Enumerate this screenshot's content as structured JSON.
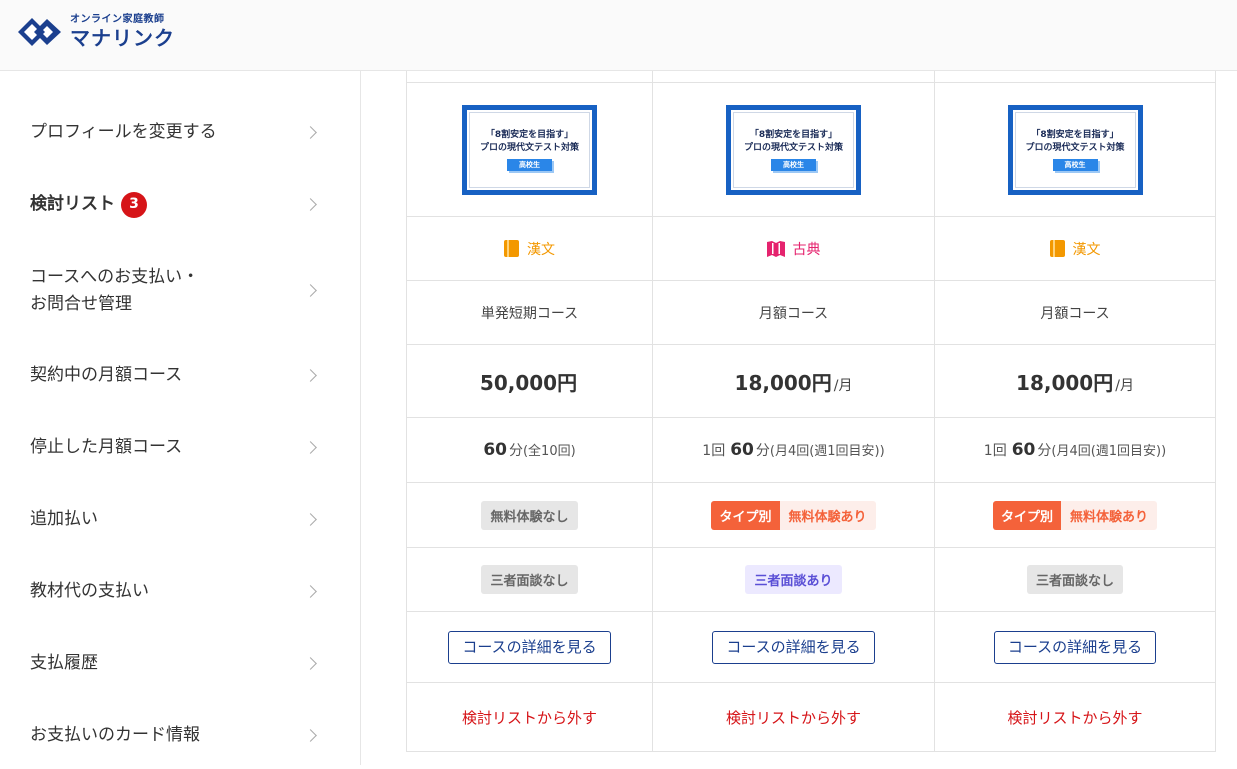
{
  "brand": {
    "sub": "オンライン家庭教師",
    "name": "マナリンク",
    "colors": {
      "primary": "#1b3f8e",
      "accent": "#1761c3",
      "danger": "#d61418"
    }
  },
  "sidebar": {
    "items": [
      {
        "label": "プロフィールを変更する"
      },
      {
        "label": "検討リスト",
        "badge": "3"
      },
      {
        "label": "コースへのお支払い・",
        "label2": "お問合せ管理"
      },
      {
        "label": "契約中の月額コース"
      },
      {
        "label": "停止した月額コース"
      },
      {
        "label": "追加払い"
      },
      {
        "label": "教材代の支払い"
      },
      {
        "label": "支払履歴"
      },
      {
        "label": "お支払いのカード情報"
      }
    ]
  },
  "courses": [
    {
      "thumb": {
        "line1": "「8割安定を目指す」",
        "line2": "プロの現代文テスト対策",
        "tag": "高校生"
      },
      "subject": {
        "label": "漢文",
        "icon": "book-icon",
        "color": "#f39800"
      },
      "type": "単発短期コース",
      "price": "50,000円",
      "price_unit": "",
      "duration": {
        "lead": "",
        "minutes": "60",
        "unit": "分",
        "note": "(全10回)"
      },
      "trial": {
        "type_label": "",
        "label": "無料体験なし",
        "available": false
      },
      "interview": {
        "label": "三者面談なし",
        "available": false
      },
      "detail_button": "コースの詳細を見る",
      "remove_link": "検討リストから外す"
    },
    {
      "thumb": {
        "line1": "「8割安定を目指す」",
        "line2": "プロの現代文テスト対策",
        "tag": "高校生"
      },
      "subject": {
        "label": "古典",
        "icon": "open-book-icon",
        "color": "#e5236e"
      },
      "type": "月額コース",
      "price": "18,000円",
      "price_unit": "/月",
      "duration": {
        "lead": "1回",
        "minutes": "60",
        "unit": "分",
        "note": "(月4回(週1回目安))"
      },
      "trial": {
        "type_label": "タイプ別",
        "label": "無料体験あり",
        "available": true
      },
      "interview": {
        "label": "三者面談あり",
        "available": true
      },
      "detail_button": "コースの詳細を見る",
      "remove_link": "検討リストから外す"
    },
    {
      "thumb": {
        "line1": "「8割安定を目指す」",
        "line2": "プロの現代文テスト対策",
        "tag": "高校生"
      },
      "subject": {
        "label": "漢文",
        "icon": "book-icon",
        "color": "#f39800"
      },
      "type": "月額コース",
      "price": "18,000円",
      "price_unit": "/月",
      "duration": {
        "lead": "1回",
        "minutes": "60",
        "unit": "分",
        "note": "(月4回(週1回目安))"
      },
      "trial": {
        "type_label": "タイプ別",
        "label": "無料体験あり",
        "available": true
      },
      "interview": {
        "label": "三者面談なし",
        "available": false
      },
      "detail_button": "コースの詳細を見る",
      "remove_link": "検討リストから外す"
    }
  ]
}
